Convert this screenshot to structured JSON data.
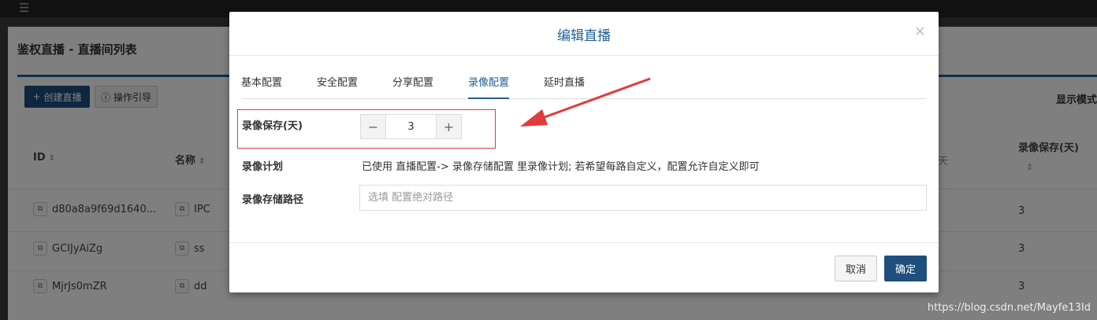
{
  "background": {
    "page_title": "鉴权直播 - 直播间列表",
    "create_button": "创建直播",
    "guide_button": "操作引导",
    "display_label": "显示模式",
    "columns": {
      "id": "ID",
      "name": "名称",
      "record_days": "录像保存(天)",
      "day": "天"
    },
    "rows": [
      {
        "id": "d80a8a9f69d1640...",
        "name": "IPC",
        "record_days": "3"
      },
      {
        "id": "GCIJyAiZg",
        "name": "ss",
        "record_days": "3"
      },
      {
        "id": "MjrJs0mZR",
        "name": "dd",
        "record_days": "3"
      }
    ]
  },
  "modal": {
    "title": "编辑直播",
    "close": "×",
    "tabs": [
      "基本配置",
      "安全配置",
      "分享配置",
      "录像配置",
      "延时直播"
    ],
    "active_tab": 3,
    "record_save": {
      "label": "录像保存(天)",
      "value": "3",
      "minus": "−",
      "plus": "+"
    },
    "record_plan": {
      "label": "录像计划",
      "text": "已使用 直播配置-> 录像存储配置 里录像计划; 若希望每路自定义，配置允许自定义即可"
    },
    "record_path": {
      "label": "录像存储路径",
      "value": "",
      "placeholder": "选填 配置绝对路径"
    },
    "cancel": "取消",
    "ok": "确定"
  },
  "watermark": "https://blog.csdn.net/Mayfe13Id",
  "colors": {
    "primary": "#1f4f7c",
    "highlight": "#e23b3b",
    "title": "#1f5f97"
  },
  "icons": {
    "menu": "hamburger-icon",
    "plus": "plus-icon",
    "info": "info-icon",
    "copy": "copy-icon",
    "sort": "sort-icon"
  }
}
